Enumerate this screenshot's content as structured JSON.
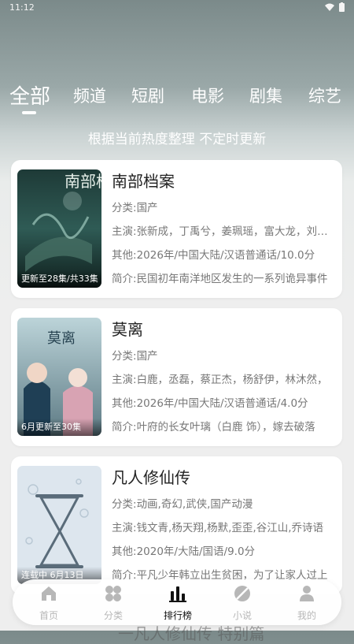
{
  "status_bar": {
    "time": "11:12"
  },
  "tabs": [
    {
      "label": "全部"
    },
    {
      "label": "频道"
    },
    {
      "label": "短剧"
    },
    {
      "label": "电影"
    },
    {
      "label": "剧集"
    },
    {
      "label": "综艺"
    }
  ],
  "subtitle": "根据当前热度整理 不定时更新",
  "labels": {
    "category": "分类:",
    "cast": "主演:",
    "other": "其他:",
    "intro": "简介:"
  },
  "items": [
    {
      "title": "南部档案",
      "caption": "更新至28集/共33集",
      "category": "国产",
      "cast": "张新成，丁禹兮，姜珮瑶，富大龙，刘奕君",
      "other": "2026年/中国大陆/汉语普通话/10.0分",
      "intro": "民国初年南洋地区发生的一系列诡异事件",
      "poster_text": "南部档案"
    },
    {
      "title": "莫离",
      "caption": "6月更新至30集",
      "category": "国产",
      "cast": "白鹿，丞磊，蔡正杰，杨舒伊，林沐然，",
      "other": "2026年/中国大陆/汉语普通话/4.0分",
      "intro": "叶府的长女叶璃（白鹿 饰），嫁去破落",
      "poster_text": "莫离"
    },
    {
      "title": "凡人修仙传",
      "caption": "连载中 6月13日",
      "category": "动画,奇幻,武侠,国产动漫",
      "cast": "钱文青,杨天翔,杨默,歪歪,谷江山,乔诗语",
      "other": "2020年/大陆/国语/9.0分",
      "intro": "平凡少年韩立出生贫困，为了让家人过上",
      "poster_text": ""
    }
  ],
  "nav": [
    {
      "label": "首页",
      "icon": "home-icon"
    },
    {
      "label": "分类",
      "icon": "category-icon"
    },
    {
      "label": "排行榜",
      "icon": "ranking-icon"
    },
    {
      "label": "小说",
      "icon": "novel-icon"
    },
    {
      "label": "我的",
      "icon": "profile-icon"
    }
  ],
  "peek_text": "一凡人修仙传 特别篇"
}
